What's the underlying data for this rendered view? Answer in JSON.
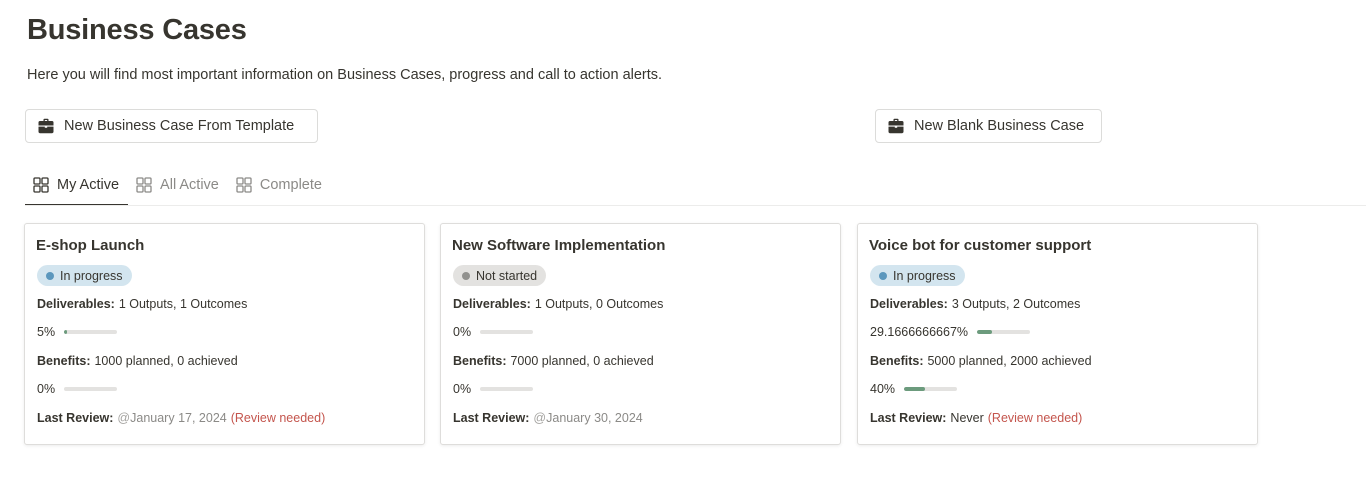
{
  "page": {
    "title": "Business Cases",
    "subtitle": "Here you will find most important information on Business Cases, progress and call to action alerts."
  },
  "buttons": {
    "template": "New Business Case From Template",
    "blank": "New Blank Business Case",
    "icon": "briefcase-icon"
  },
  "tabs": [
    {
      "label": "My Active",
      "icon": "gallery-icon",
      "active": true
    },
    {
      "label": "All Active",
      "icon": "gallery-icon",
      "active": false
    },
    {
      "label": "Complete",
      "icon": "gallery-icon",
      "active": false
    }
  ],
  "labels": {
    "deliverables": "Deliverables:",
    "benefits": "Benefits:",
    "last_review": "Last Review:",
    "mention_prefix": "@"
  },
  "colors": {
    "in_progress_bg": "#d3e5ef",
    "in_progress_dot": "#5b97bd",
    "not_started_bg": "#e3e2e0",
    "not_started_dot": "#91918e",
    "progress_fill": "#6c9b7d",
    "warning": "#c4554d"
  },
  "cards": [
    {
      "title": "E-shop Launch",
      "status": "In progress",
      "status_key": "in_progress",
      "deliverables": "1 Outputs, 1 Outcomes",
      "deliverables_progress_label": "5%",
      "deliverables_progress": 0.05,
      "benefits": "1000 planned, 0 achieved",
      "benefits_progress_label": "0%",
      "benefits_progress": 0,
      "last_review": "January 17, 2024",
      "last_review_is_date": true,
      "review_alert": "(Review needed)"
    },
    {
      "title": "New Software Implementation",
      "status": "Not started",
      "status_key": "not_started",
      "deliverables": "1 Outputs, 0 Outcomes",
      "deliverables_progress_label": "0%",
      "deliverables_progress": 0,
      "benefits": "7000 planned, 0 achieved",
      "benefits_progress_label": "0%",
      "benefits_progress": 0,
      "last_review": "January 30, 2024",
      "last_review_is_date": true,
      "review_alert": ""
    },
    {
      "title": "Voice bot for customer support",
      "status": "In progress",
      "status_key": "in_progress",
      "deliverables": "3 Outputs, 2 Outcomes",
      "deliverables_progress_label": "29.1666666667%",
      "deliverables_progress": 0.291666666667,
      "benefits": "5000 planned, 2000 achieved",
      "benefits_progress_label": "40%",
      "benefits_progress": 0.4,
      "last_review": "Never",
      "last_review_is_date": false,
      "review_alert": "(Review needed)"
    }
  ]
}
